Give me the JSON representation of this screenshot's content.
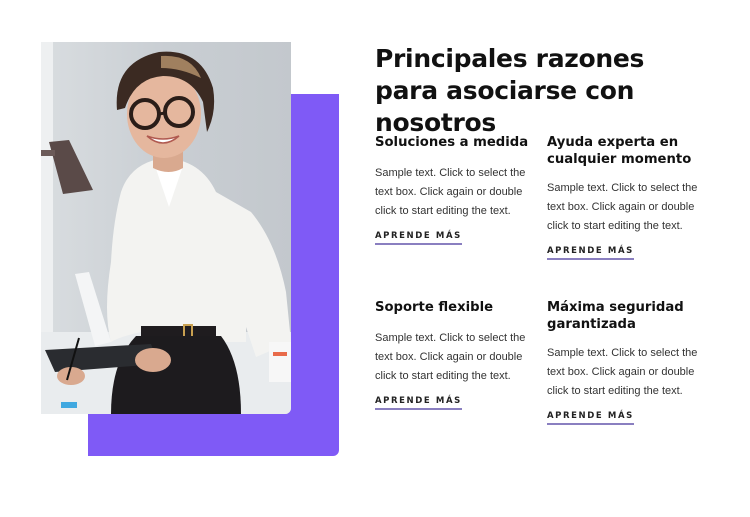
{
  "section": {
    "title": "Principales razones para asociarse con nosotros",
    "image_alt": "Smiling woman with glasses in white blouse holding a tablet in an office",
    "accent_color": "#7f5af6",
    "features": [
      {
        "heading": "Soluciones a medida",
        "text": "Sample text. Click to select the text box. Click again or double click to start editing the text.",
        "link_label": "APRENDE MÁS"
      },
      {
        "heading": "Ayuda experta en cualquier momento",
        "text": "Sample text. Click to select the text box. Click again or double click to start editing the text.",
        "link_label": "APRENDE MÁS"
      },
      {
        "heading": "Soporte flexible",
        "text": "Sample text. Click to select the text box. Click again or double click to start editing the text.",
        "link_label": "APRENDE MÁS"
      },
      {
        "heading": "Máxima seguridad garantizada",
        "text": "Sample text. Click to select the text box. Click again or double click to start editing the text.",
        "link_label": "APRENDE MÁS"
      }
    ]
  }
}
